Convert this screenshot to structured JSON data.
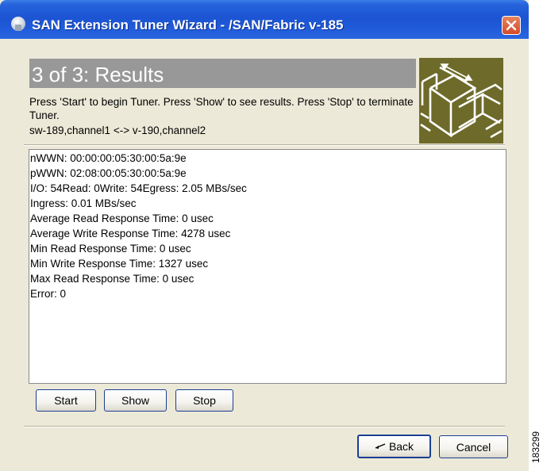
{
  "window": {
    "title": "SAN Extension Tuner Wizard - /SAN/Fabric v-185"
  },
  "header": {
    "step_title": "3 of 3: Results",
    "instructions": "Press 'Start' to begin Tuner. Press 'Show' to see results. Press 'Stop' to terminate Tuner.",
    "channel": "sw-189,channel1 <-> v-190,channel2"
  },
  "results": {
    "lines": [
      "nWWN: 00:00:00:05:30:00:5a:9e",
      "pWWN: 02:08:00:05:30:00:5a:9e",
      "I/O: 54Read: 0Write: 54Egress: 2.05 MBs/sec",
      "Ingress: 0.01 MBs/sec",
      "Average Read Response Time: 0 usec",
      "Average Write Response Time: 4278 usec",
      "Min Read Response Time: 0 usec",
      "Min Write Response Time: 1327 usec",
      "Max Read Response Time: 0 usec",
      "Error: 0"
    ]
  },
  "controls": {
    "start_label": "Start",
    "show_label": "Show",
    "stop_label": "Stop"
  },
  "footer": {
    "back_label": "Back",
    "cancel_label": "Cancel"
  },
  "figure_number": "183299",
  "icons": {
    "app": "java-cup-icon",
    "close": "close-icon",
    "logo": "san-extension-logo",
    "back": "back-arrow-icon"
  },
  "colors": {
    "titlebar": "#2663dc",
    "close_button": "#d34a2a",
    "header_band": "#989898",
    "logo_background": "#6e6a2a",
    "window_background": "#ece9d8"
  }
}
